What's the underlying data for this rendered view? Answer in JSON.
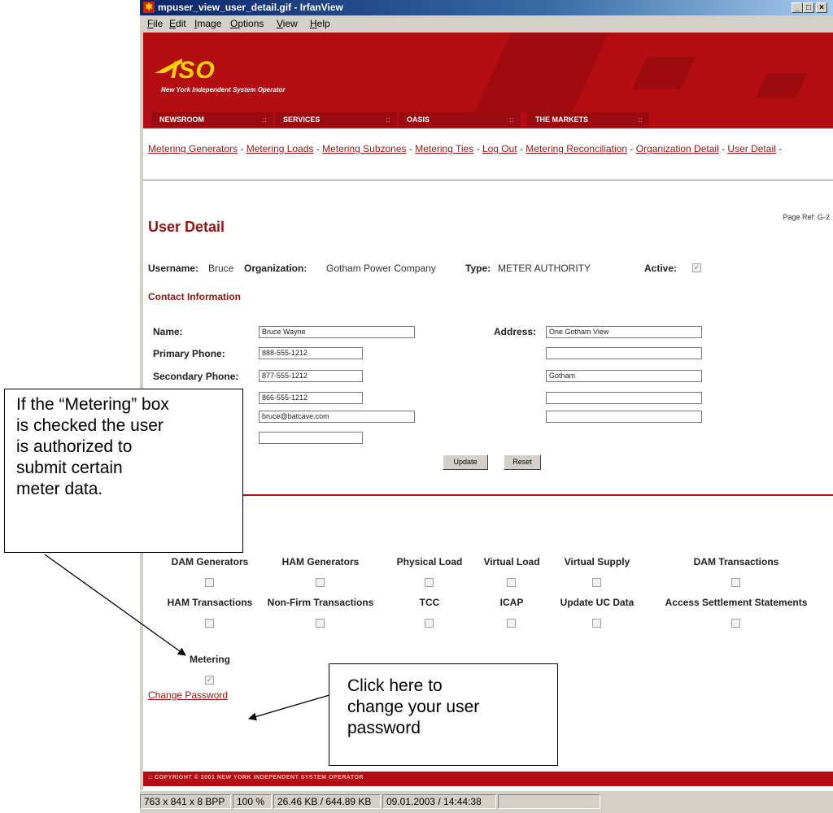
{
  "window": {
    "title": "mpuser_view_user_detail.gif - IrfanView",
    "menu": [
      "File",
      "Edit",
      "Image",
      "Options",
      "View",
      "Help"
    ],
    "controls": {
      "minimize": "_",
      "maximize": "□",
      "close": "×"
    }
  },
  "site": {
    "logo": "ISO",
    "logo_subtitle": "New York Independent System Operator",
    "nav": [
      "NEWSROOM",
      "SERVICES",
      "OASIS",
      "THE MARKETS"
    ],
    "breadcrumb": [
      "Metering Generators",
      "Metering Loads",
      "Metering Subzones",
      "Metering Ties",
      "Log Out",
      "Metering Reconciliation",
      "Organization Detail",
      "User Detail"
    ],
    "page_ref": "Page Ref: G-2",
    "footer": ":: COPYRIGHT © 2001 NEW YORK INDEPENDENT SYSTEM OPERATOR"
  },
  "user": {
    "title": "User Detail",
    "username_label": "Username:",
    "username": "Bruce",
    "organization_label": "Organization:",
    "organization": "Gotham Power Company",
    "type_label": "Type:",
    "type": "METER AUTHORITY",
    "active_label": "Active:",
    "active": true
  },
  "contact": {
    "heading": "Contact Information",
    "name_label": "Name:",
    "name": "Bruce Wayne",
    "primary_phone_label": "Primary Phone:",
    "primary_phone": "888-555-1212",
    "secondary_phone_label": "Secondary Phone:",
    "secondary_phone": "877-555-1212",
    "fax": "866-555-1212",
    "email": "bruce@batcave.com",
    "extra": "",
    "address_label": "Address:",
    "address_lines": [
      "One Gotham View",
      "",
      "Gotham",
      "",
      ""
    ],
    "update_label": "Update",
    "reset_label": "Reset"
  },
  "permissions": [
    {
      "label": "DAM Generators",
      "checked": false
    },
    {
      "label": "HAM Generators",
      "checked": false
    },
    {
      "label": "Physical Load",
      "checked": false
    },
    {
      "label": "Virtual Load",
      "checked": false
    },
    {
      "label": "Virtual Supply",
      "checked": false
    },
    {
      "label": "DAM Transactions",
      "checked": false
    },
    {
      "label": "HAM Transactions",
      "checked": false
    },
    {
      "label": "Non-Firm Transactions",
      "checked": false
    },
    {
      "label": "TCC",
      "checked": false
    },
    {
      "label": "ICAP",
      "checked": false
    },
    {
      "label": "Update UC Data",
      "checked": false
    },
    {
      "label": "Access Settlement Statements",
      "checked": false
    },
    {
      "label": "Metering",
      "checked": true
    }
  ],
  "change_password": "Change Password",
  "statusbar": [
    "763 x 841 x 8 BPP",
    "100 %",
    "26.46 KB / 644.89 KB",
    "09.01.2003 / 14:44:38"
  ],
  "callouts": {
    "metering_lines": [
      "If the “Metering” box",
      "is checked the user",
      "is authorized to",
      "submit certain",
      "meter data."
    ],
    "password_lines": [
      "Click here to",
      "change your user",
      "password"
    ]
  },
  "colors": {
    "brand_red": "#b40d12",
    "link_red": "#9a1212",
    "logo_yellow": "#ffd400"
  }
}
